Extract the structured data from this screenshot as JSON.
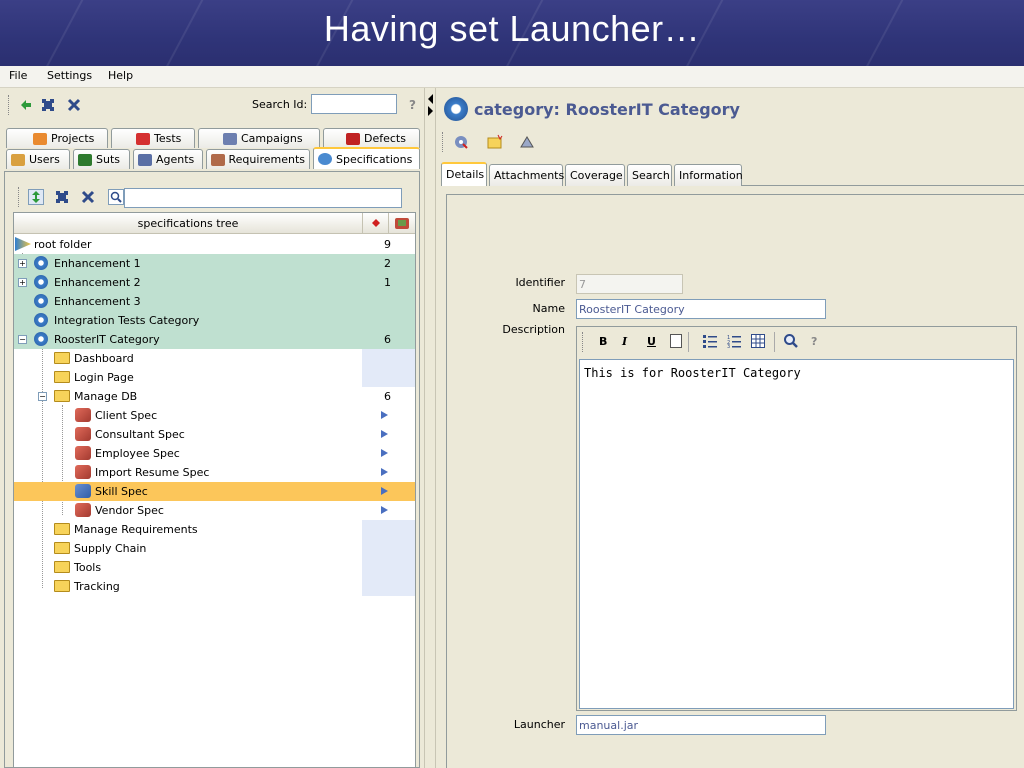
{
  "slide": {
    "title": "Having set Launcher…"
  },
  "menu": {
    "items": [
      "File",
      "Settings",
      "Help"
    ]
  },
  "left_toolbar": {
    "search_label": "Search Id:",
    "search_value": "",
    "help": "?"
  },
  "tabs_row1": [
    {
      "label": "Projects",
      "icon": "projects-icon"
    },
    {
      "label": "Tests",
      "icon": "tests-icon"
    },
    {
      "label": "Campaigns",
      "icon": "campaigns-icon"
    },
    {
      "label": "Defects",
      "icon": "defects-icon"
    }
  ],
  "tabs_row2": [
    {
      "label": "Users",
      "icon": "users-icon"
    },
    {
      "label": "Suts",
      "icon": "suts-icon"
    },
    {
      "label": "Agents",
      "icon": "agents-icon"
    },
    {
      "label": "Requirements",
      "icon": "requirements-icon"
    },
    {
      "label": "Specifications",
      "icon": "specifications-icon",
      "active": true
    }
  ],
  "tree": {
    "header": "specifications tree",
    "rows": [
      {
        "label": "root folder",
        "count": "9"
      },
      {
        "label": "Enhancement 1",
        "count": "2"
      },
      {
        "label": "Enhancement 2",
        "count": "1"
      },
      {
        "label": "Enhancement 3",
        "count": ""
      },
      {
        "label": "Integration Tests Category",
        "count": ""
      },
      {
        "label": "RoosterIT Category",
        "count": "6"
      },
      {
        "label": "Dashboard",
        "count": ""
      },
      {
        "label": "Login Page",
        "count": ""
      },
      {
        "label": "Manage DB",
        "count": "6"
      },
      {
        "label": "Client Spec",
        "count": ""
      },
      {
        "label": "Consultant Spec",
        "count": ""
      },
      {
        "label": "Employee Spec",
        "count": ""
      },
      {
        "label": "Import Resume Spec",
        "count": ""
      },
      {
        "label": "Skill Spec",
        "count": ""
      },
      {
        "label": "Vendor Spec",
        "count": ""
      },
      {
        "label": "Manage Requirements",
        "count": ""
      },
      {
        "label": "Supply Chain",
        "count": ""
      },
      {
        "label": "Tools",
        "count": ""
      },
      {
        "label": "Tracking",
        "count": ""
      }
    ]
  },
  "right": {
    "title": "category: RoosterIT Category",
    "tabs": [
      "Details",
      "Attachments",
      "Coverage",
      "Search",
      "Information"
    ],
    "fields": {
      "identifier_label": "Identifier",
      "identifier_value": "7",
      "name_label": "Name",
      "name_value": "RoosterIT Category",
      "description_label": "Description",
      "description_value": "This is for RoosterIT Category",
      "launcher_label": "Launcher",
      "launcher_value": "manual.jar"
    },
    "editor_toolbar": {
      "bold": "B",
      "italic": "I",
      "underline": "U",
      "help": "?"
    }
  }
}
